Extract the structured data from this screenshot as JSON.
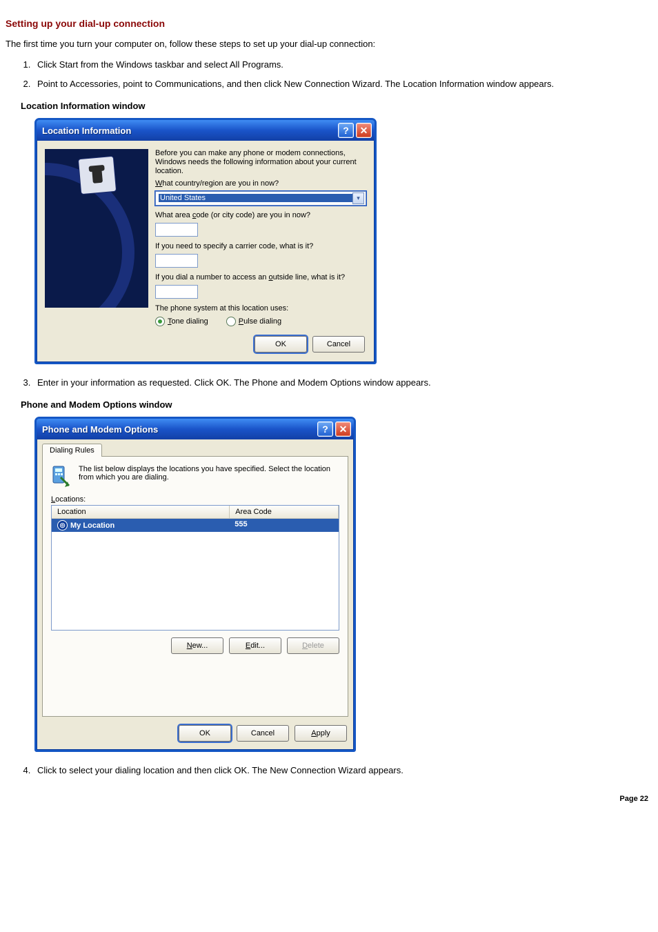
{
  "heading": "Setting up your dial-up connection",
  "intro": "The first time you turn your computer on, follow these steps to set up your dial-up connection:",
  "steps": {
    "s1": "Click Start from the Windows taskbar and select All Programs.",
    "s2": "Point to Accessories, point to Communications, and then click New Connection Wizard. The Location Information window appears.",
    "s3": "Enter in your information as requested. Click OK. The Phone and Modem Options window appears.",
    "s4": "Click to select your dialing location and then click OK. The New Connection Wizard appears."
  },
  "caption1": "Location Information window",
  "dialog1": {
    "title": "Location Information",
    "help": "?",
    "close": "✕",
    "body1": "Before you can make any phone or modem connections, Windows needs the following information about your current location.",
    "q_country": "What country/region are you in now?",
    "country_value": "United States",
    "q_area": "What area code (or city code) are you in now?",
    "q_carrier": "If you need to specify a carrier code, what is it?",
    "q_outside": "If you dial a number to access an outside line, what is it?",
    "phone_sys": "The phone system at this location uses:",
    "tone": "Tone dialing",
    "pulse": "Pulse dialing",
    "ok": "OK",
    "cancel": "Cancel"
  },
  "caption2": "Phone and Modem Options window",
  "dialog2": {
    "title": "Phone and Modem Options",
    "tab": "Dialing Rules",
    "desc": "The list below displays the locations you have specified. Select the location from which you are dialing.",
    "list_label": "Locations:",
    "col_location": "Location",
    "col_area": "Area Code",
    "row_name": "My Location",
    "row_area": "555",
    "btn_new": "New...",
    "btn_edit": "Edit...",
    "btn_delete": "Delete",
    "ok": "OK",
    "cancel": "Cancel",
    "apply": "Apply"
  },
  "page_num": "Page 22"
}
